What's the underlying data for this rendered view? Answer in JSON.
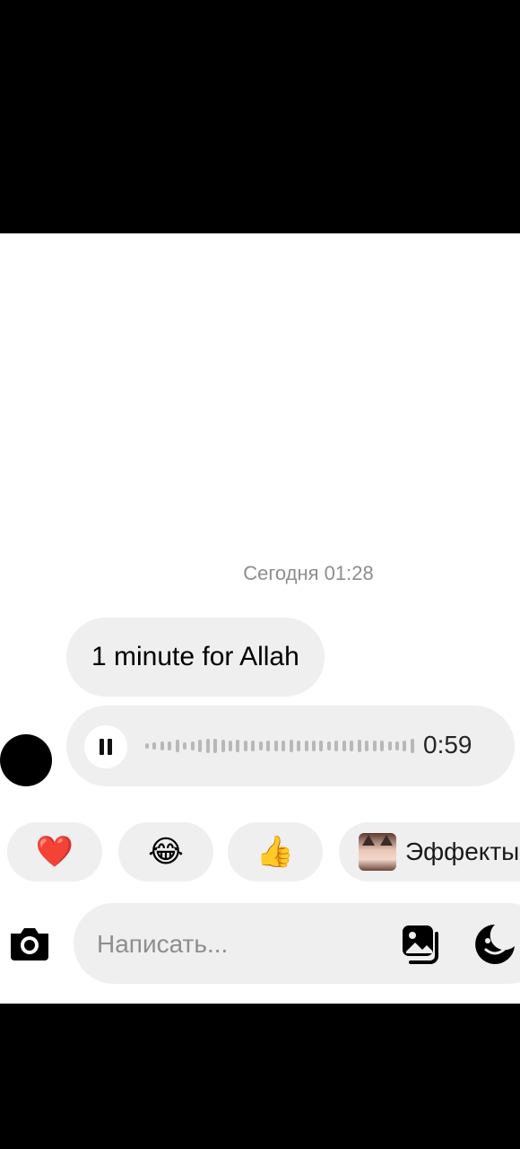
{
  "chat": {
    "timestamp": "Сегодня 01:28",
    "messages": [
      {
        "type": "text",
        "text": "1 minute for Allah"
      },
      {
        "type": "voice",
        "duration": "0:59",
        "state": "playing"
      }
    ]
  },
  "reactions": [
    {
      "emoji": "❤️",
      "icon": "heart-icon"
    },
    {
      "emoji": "😂",
      "icon": "laughing-icon"
    },
    {
      "emoji": "👍",
      "icon": "thumbs-up-icon"
    }
  ],
  "effects": {
    "label": "Эффекты"
  },
  "composer": {
    "placeholder": "Написать...",
    "value": ""
  },
  "colors": {
    "bubble": "#efefef",
    "timestamp": "#8e8e8e",
    "background": "#ffffff"
  }
}
